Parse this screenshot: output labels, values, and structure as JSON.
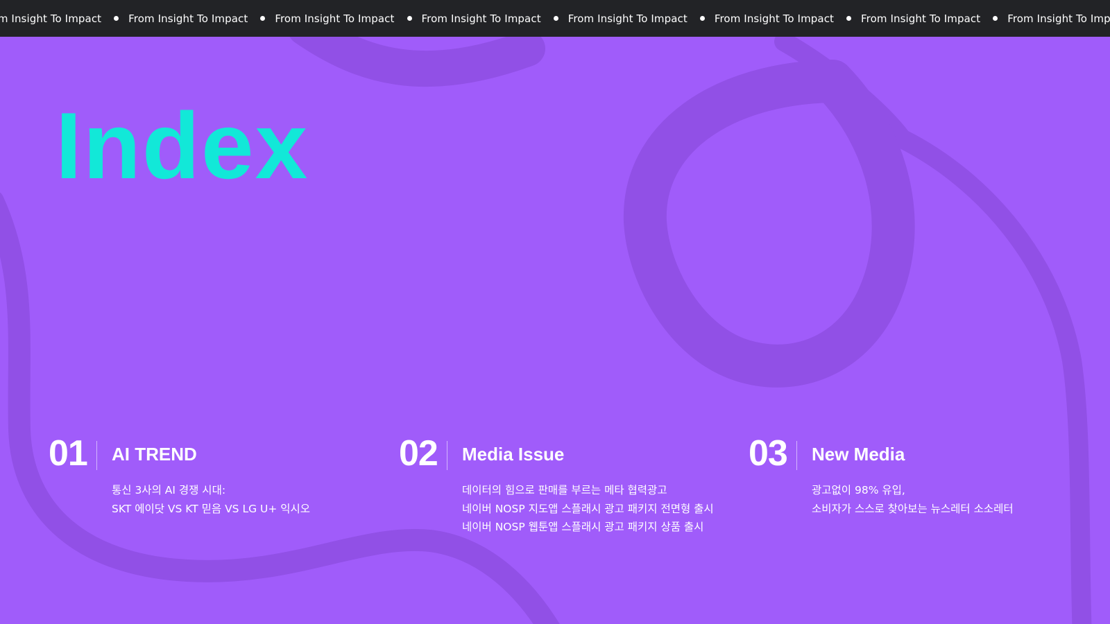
{
  "ticker": {
    "items": [
      "From Insight To Impact",
      "From Insight To Impact",
      "From Insight To Impact",
      "From Insight To Impact",
      "From Insight To Impact",
      "From Insight To Impact",
      "From Insight To Impact",
      "From Insight To Impact",
      "From Insight To Impact"
    ]
  },
  "title": "Index",
  "sections": [
    {
      "number": "01",
      "heading": "AI TREND",
      "lines": [
        "통신 3사의 AI 경쟁 시대:",
        "SKT 에이닷 VS KT 믿음 VS LG U+ 익시오"
      ]
    },
    {
      "number": "02",
      "heading": "Media Issue",
      "lines": [
        "데이터의 힘으로 판매를 부르는 메타 협력광고",
        "네이버 NOSP 지도앱 스플래시 광고 패키지 전면형 출시",
        "네이버 NOSP 웹툰앱 스플래시 광고 패키지 상품 출시"
      ]
    },
    {
      "number": "03",
      "heading": "New Media",
      "lines": [
        "광고없이 98% 유입,",
        "소비자가 스스로 찾아보는 뉴스레터 소소레터"
      ]
    }
  ],
  "colors": {
    "background": "#a05cfa",
    "swirl": "#9150e6",
    "ticker_bg": "#222326",
    "title": "#12e8d8",
    "text": "#ffffff"
  }
}
